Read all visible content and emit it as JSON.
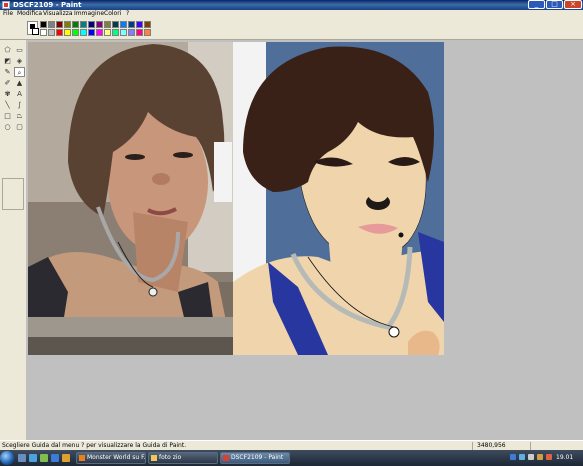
{
  "window": {
    "title": "DSCF2109 - Paint"
  },
  "window_buttons": {
    "minimize": "_",
    "maximize": "□",
    "close": "×"
  },
  "menu": [
    "File",
    "Modifica",
    "Visualizza",
    "Immagine",
    "Colori",
    "?"
  ],
  "palette": {
    "row1": [
      "#000000",
      "#808080",
      "#800000",
      "#808000",
      "#008000",
      "#008080",
      "#000080",
      "#800080",
      "#808040",
      "#004040",
      "#0080ff",
      "#004080",
      "#4000ff",
      "#804000"
    ],
    "row2": [
      "#ffffff",
      "#c0c0c0",
      "#ff0000",
      "#ffff00",
      "#00ff00",
      "#00ffff",
      "#0000ff",
      "#ff00ff",
      "#ffff80",
      "#00ff80",
      "#80ffff",
      "#8080ff",
      "#ff0080",
      "#ff8040"
    ]
  },
  "tools": [
    {
      "name": "free-select-icon",
      "glyph": "⬠"
    },
    {
      "name": "rect-select-icon",
      "glyph": "▭"
    },
    {
      "name": "eraser-icon",
      "glyph": "◩"
    },
    {
      "name": "fill-icon",
      "glyph": "◈"
    },
    {
      "name": "picker-icon",
      "glyph": "✎"
    },
    {
      "name": "magnifier-icon",
      "glyph": "⌕"
    },
    {
      "name": "pencil-icon",
      "glyph": "✐"
    },
    {
      "name": "brush-icon",
      "glyph": "▲"
    },
    {
      "name": "airbrush-icon",
      "glyph": "✾"
    },
    {
      "name": "text-icon",
      "glyph": "A"
    },
    {
      "name": "line-icon",
      "glyph": "╲"
    },
    {
      "name": "curve-icon",
      "glyph": "∫"
    },
    {
      "name": "rectangle-icon",
      "glyph": "□"
    },
    {
      "name": "polygon-icon",
      "glyph": "⏢"
    },
    {
      "name": "ellipse-icon",
      "glyph": "○"
    },
    {
      "name": "rounded-rect-icon",
      "glyph": "▢"
    }
  ],
  "status": {
    "message": "Scegliere Guida dal menu ? per visualizzare la Guida di Paint.",
    "coords": "3480,956"
  },
  "taskbar": {
    "tasks": [
      {
        "label": "Monster World su F...",
        "icon_color": "#e8801a",
        "active": false
      },
      {
        "label": "foto zio",
        "icon_color": "#f0c85a",
        "active": false
      },
      {
        "label": "DSCF2109 - Paint",
        "icon_color": "#d84030",
        "active": true
      }
    ],
    "clock": "19.01"
  },
  "colors": {
    "workspace": "#c0c0c0",
    "titlebar": "#1a3f86",
    "taskbar": "#1d2735"
  }
}
